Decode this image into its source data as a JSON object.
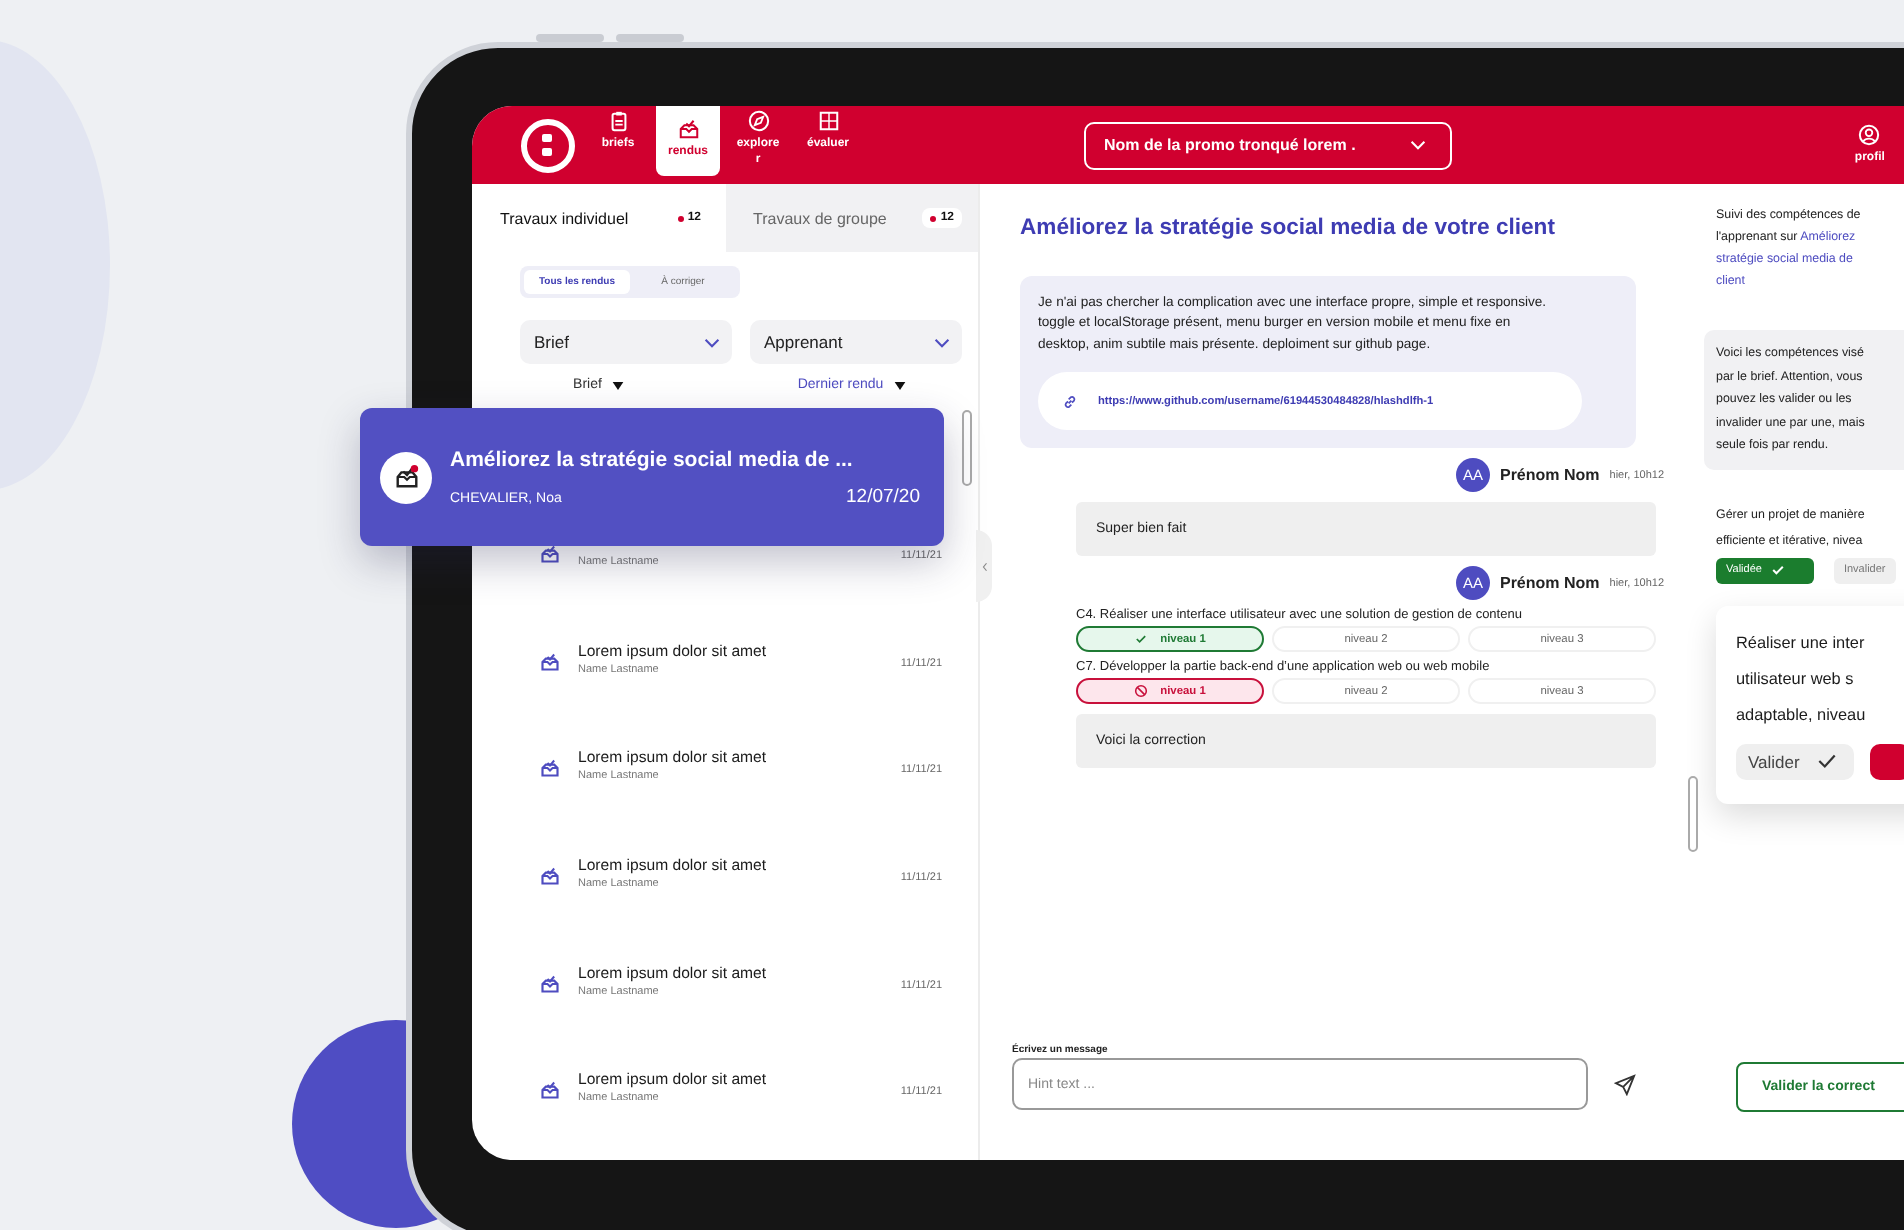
{
  "header": {
    "nav": [
      {
        "label": "briefs",
        "selected": false
      },
      {
        "label": "rendus",
        "selected": true
      },
      {
        "label": "explorer",
        "selected": false
      },
      {
        "label": "évaluer",
        "selected": false
      }
    ],
    "promo_select": "Nom de la promo tronqué lorem .",
    "profile": "profil"
  },
  "left": {
    "tabs": [
      {
        "label": "Travaux individuel",
        "count": "12",
        "selected": true
      },
      {
        "label": "Travaux de groupe",
        "count": "12",
        "selected": false
      }
    ],
    "segments": [
      {
        "label": "Tous les rendus",
        "selected": true
      },
      {
        "label": "À corriger",
        "selected": false
      }
    ],
    "filters": [
      "Brief",
      "Apprenant"
    ],
    "sort": [
      {
        "label": "Brief",
        "active": false
      },
      {
        "label": "Dernier rendu",
        "active": true
      }
    ],
    "items": [
      {
        "name": "Name Lastname",
        "date": "11/11/21"
      },
      {
        "title": "Lorem ipsum dolor sit amet",
        "name": "Name Lastname",
        "date": "11/11/21"
      },
      {
        "title": "Lorem ipsum dolor sit amet",
        "name": "Name Lastname",
        "date": "11/11/21"
      },
      {
        "title": "Lorem ipsum dolor sit amet",
        "name": "Name Lastname",
        "date": "11/11/21"
      },
      {
        "title": "Lorem ipsum dolor sit amet",
        "name": "Name Lastname",
        "date": "11/11/21"
      },
      {
        "title": "Lorem ipsum dolor sit amet",
        "name": "Name Lastname",
        "date": "11/11/21"
      }
    ],
    "floating_card": {
      "title": "Améliorez la stratégie social media de ...",
      "name": "CHEVALIER, Noa",
      "date": "12/07/20"
    }
  },
  "center": {
    "title": "Améliorez la stratégie social media de votre client",
    "submission": {
      "text": "Je n'ai pas chercher la complication avec une interface propre, simple et responsive. toggle et localStorage présent, menu burger en version mobile et menu fixe en desktop, anim subtile mais présente. deploiment sur github page.",
      "link": "https://www.github.com/username/61944530484828/hlashdlfh-1"
    },
    "comments": [
      {
        "avatar": "AA",
        "author": "Prénom Nom",
        "time": "hier, 10h12",
        "message": "Super bien fait"
      },
      {
        "avatar": "AA",
        "author": "Prénom Nom",
        "time": "hier, 10h12",
        "skills": [
          {
            "label": "C4. Réaliser une interface utilisateur avec une solution de gestion de contenu",
            "levels": [
              {
                "label": "niveau 1",
                "validated": true,
                "rejected": false
              },
              {
                "label": "niveau 2",
                "validated": false,
                "rejected": false
              },
              {
                "label": "niveau 3",
                "validated": false,
                "rejected": false
              }
            ]
          },
          {
            "label": "C7. Développer la partie back-end d’une application web ou web mobile",
            "levels": [
              {
                "label": "niveau 1",
                "validated": false,
                "rejected": true
              },
              {
                "label": "niveau 2",
                "validated": false,
                "rejected": false
              },
              {
                "label": "niveau 3",
                "validated": false,
                "rejected": false
              }
            ]
          }
        ],
        "message": "Voici la correction"
      }
    ],
    "composer": {
      "label": "Écrivez un message",
      "placeholder": "Hint text ..."
    }
  },
  "right": {
    "intro": [
      {
        "text": "Suivi des compétences de"
      },
      {
        "text": "l'apprenant sur ",
        "link": "Améliorez"
      },
      {
        "link": "stratégie social media de"
      },
      {
        "link": "client"
      }
    ],
    "notice": [
      "Voici les compétences visé",
      "par le brief. Attention, vous",
      "pouvez les valider ou les",
      "invalider une par une, mais",
      "seule fois par rendu."
    ],
    "competence": {
      "lines": [
        "Gérer un projet de manière",
        "efficiente et itérative, nivea"
      ],
      "buttons": [
        {
          "label": "Validée",
          "selected": true
        },
        {
          "label": "Invalider",
          "selected": false
        }
      ]
    },
    "popup": {
      "lines": [
        "Réaliser une inter",
        "utilisateur web s",
        "adaptable, niveau"
      ],
      "buttons": [
        {
          "kind": "validate",
          "label": "Valider"
        },
        {
          "kind": "reject"
        }
      ]
    },
    "submit": "Valider la correct"
  }
}
